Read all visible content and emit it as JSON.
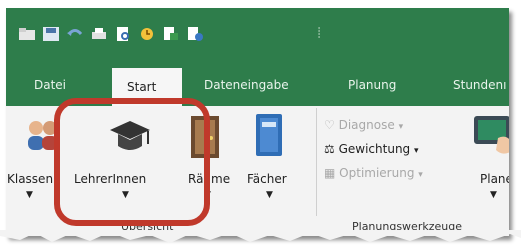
{
  "quick_access": {
    "icons": [
      "folder-icon",
      "save-icon",
      "undo-icon",
      "print-icon",
      "print-preview-icon",
      "clock-icon",
      "export-icon",
      "export-2-icon"
    ]
  },
  "tabs": [
    "Datei",
    "Start",
    "Dateneingabe",
    "Planung",
    "Stundenı"
  ],
  "active_tab": "Start",
  "groups": {
    "uebersicht": {
      "label": "Übersicht",
      "buttons": [
        "Klassen",
        "LehrerInnen",
        "Räume",
        "Fächer"
      ]
    },
    "planungswerkzeuge": {
      "label": "Planungswerkzeuge",
      "items": {
        "diagnose": "Diagnose",
        "gewichtung": "Gewichtung",
        "optimierung": "Optimierung",
        "planer": "Planer"
      }
    }
  },
  "colors": {
    "ribbon_green": "#2e7d4b",
    "highlight_red": "#c0392b"
  }
}
